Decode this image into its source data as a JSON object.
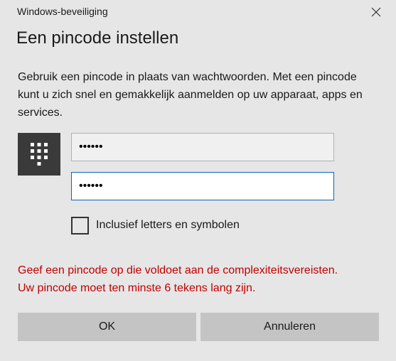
{
  "window": {
    "title": "Windows-beveiliging",
    "close_icon": "close-icon"
  },
  "dialog": {
    "heading": "Een pincode instellen",
    "description": "Gebruik een pincode in plaats van wachtwoorden. Met een pincode kunt u zich snel en gemakkelijk aanmelden op uw apparaat, apps en services.",
    "keypad_icon": "keypad-icon"
  },
  "fields": {
    "new_pin_value": "••••••",
    "confirm_pin_value": "••••••"
  },
  "options": {
    "include_letters_label": "Inclusief letters en symbolen",
    "include_letters_checked": false
  },
  "error": {
    "line1": "Geef een pincode op die voldoet aan de complexiteitsvereisten.",
    "line2": "Uw pincode moet ten minste 6 tekens lang zijn.",
    "color": "#c00000"
  },
  "buttons": {
    "ok_label": "OK",
    "cancel_label": "Annuleren"
  }
}
